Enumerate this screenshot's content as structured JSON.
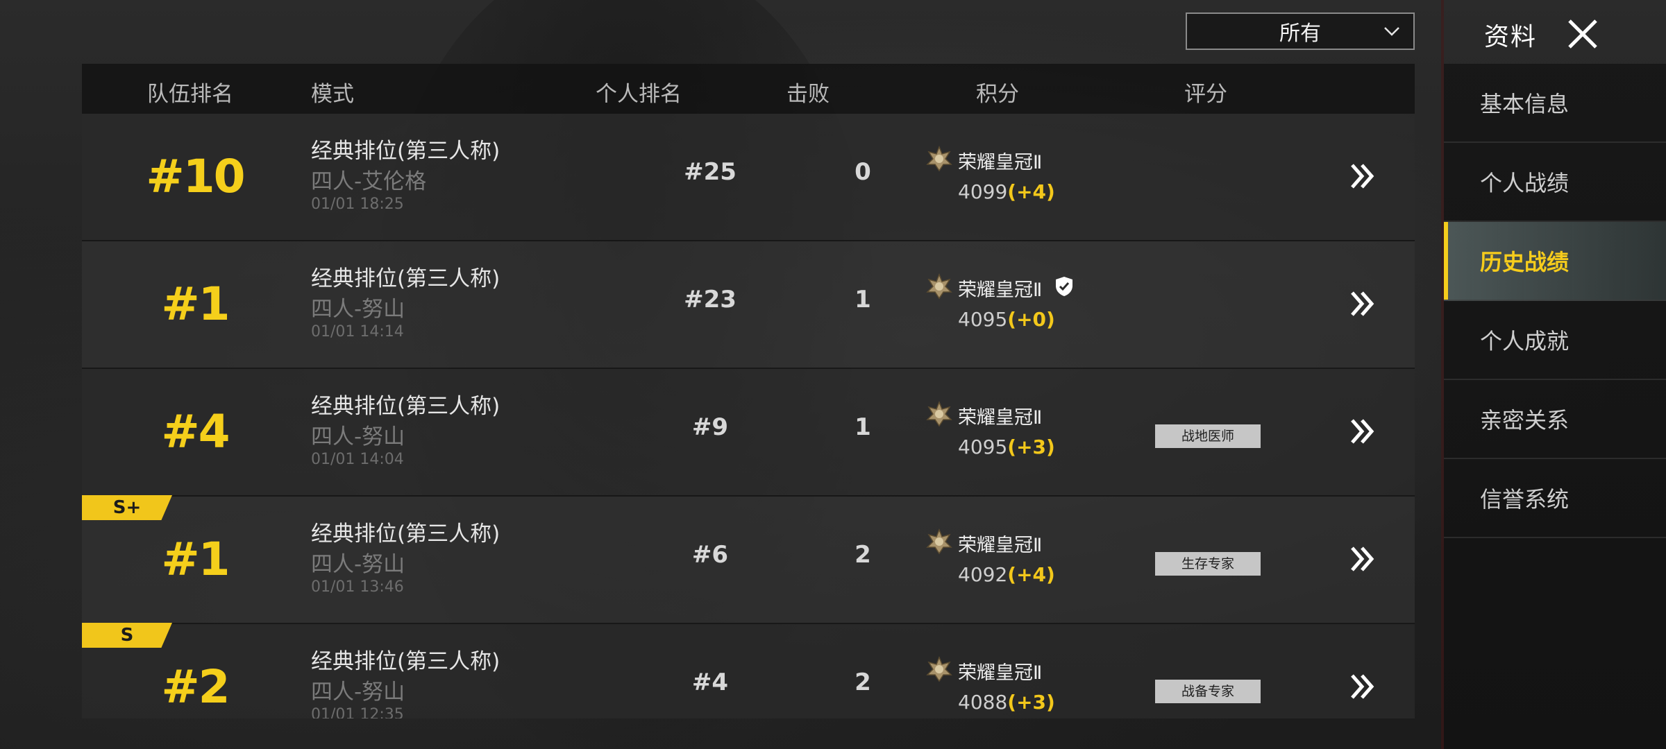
{
  "top": {
    "filter_value": "所有",
    "profile_title": "资料"
  },
  "table": {
    "headers": {
      "team_rank": "队伍排名",
      "mode": "模式",
      "personal_rank": "个人排名",
      "kills": "击败",
      "points": "积分",
      "rating": "评分"
    },
    "rows": [
      {
        "grade": "",
        "team_rank": "#10",
        "mode": "经典排位(第三人称)",
        "sub": "四人-艾伦格",
        "time": "01/01 18:25",
        "personal_rank": "#25",
        "kills": "0",
        "tier": "荣耀皇冠Ⅱ",
        "score": "4099",
        "delta": "(+4)",
        "badge": "",
        "shield": false
      },
      {
        "grade": "",
        "team_rank": "#1",
        "mode": "经典排位(第三人称)",
        "sub": "四人-努山",
        "time": "01/01 14:14",
        "personal_rank": "#23",
        "kills": "1",
        "tier": "荣耀皇冠Ⅱ",
        "score": "4095",
        "delta": "(+0)",
        "badge": "",
        "shield": true
      },
      {
        "grade": "",
        "team_rank": "#4",
        "mode": "经典排位(第三人称)",
        "sub": "四人-努山",
        "time": "01/01 14:04",
        "personal_rank": "#9",
        "kills": "1",
        "tier": "荣耀皇冠Ⅱ",
        "score": "4095",
        "delta": "(+3)",
        "badge": "战地医师",
        "shield": false
      },
      {
        "grade": "S+",
        "team_rank": "#1",
        "mode": "经典排位(第三人称)",
        "sub": "四人-努山",
        "time": "01/01 13:46",
        "personal_rank": "#6",
        "kills": "2",
        "tier": "荣耀皇冠Ⅱ",
        "score": "4092",
        "delta": "(+4)",
        "badge": "生存专家",
        "shield": false
      },
      {
        "grade": "S",
        "team_rank": "#2",
        "mode": "经典排位(第三人称)",
        "sub": "四人-努山",
        "time": "01/01 12:35",
        "personal_rank": "#4",
        "kills": "2",
        "tier": "荣耀皇冠Ⅱ",
        "score": "4088",
        "delta": "(+3)",
        "badge": "战备专家",
        "shield": false
      }
    ]
  },
  "sidebar": {
    "items": [
      {
        "label": "基本信息",
        "active": false
      },
      {
        "label": "个人战绩",
        "active": false
      },
      {
        "label": "历史战绩",
        "active": true
      },
      {
        "label": "个人成就",
        "active": false
      },
      {
        "label": "亲密关系",
        "active": false
      },
      {
        "label": "信誉系统",
        "active": false
      }
    ]
  },
  "colors": {
    "accent_yellow": "#f5cf1b",
    "badge_gray": "#c6c6c6"
  },
  "icons": {
    "close": "close-icon",
    "dropdown": "chevron-down-icon",
    "tier": "crown-tier-icon",
    "shield": "shield-check-icon",
    "row_arrow": "chevron-right-icon"
  }
}
